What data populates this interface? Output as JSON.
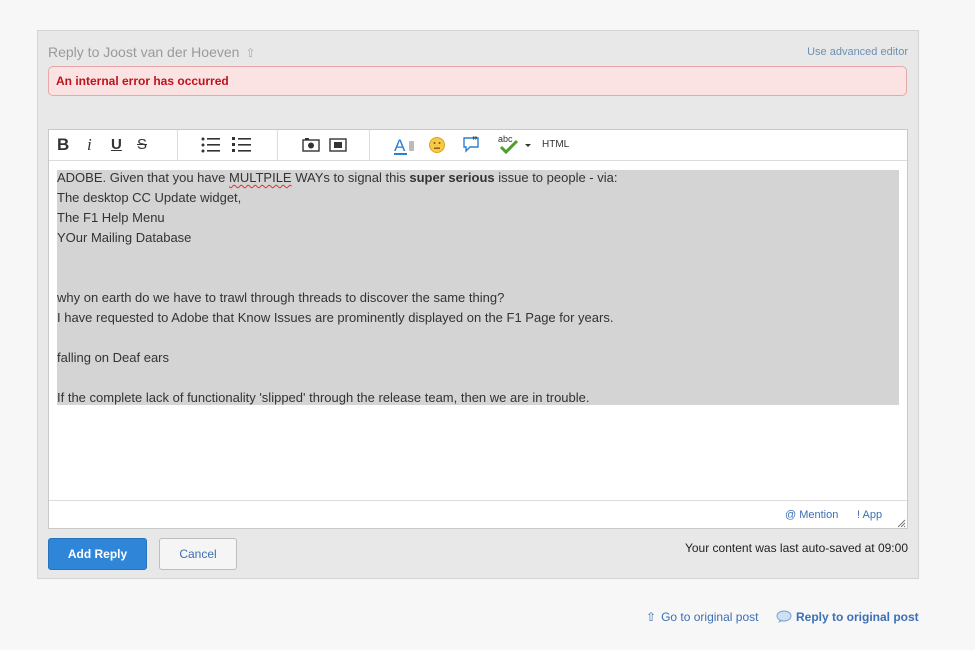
{
  "reply_header": {
    "title": "Reply to Joost van der Hoeven",
    "advanced_editor_link": "Use advanced editor"
  },
  "error": {
    "message": "An internal error has occurred"
  },
  "toolbar": {
    "bold": "B",
    "italic": "i",
    "underline": "U",
    "strike": "S",
    "spellcheck_abc": "abc",
    "html": "HTML",
    "icons": [
      "bold-icon",
      "italic-icon",
      "underline-icon",
      "strikethrough-icon",
      "bulleted-list-icon",
      "numbered-list-icon",
      "insert-image-icon",
      "insert-video-icon",
      "font-style-icon",
      "emoji-icon",
      "quote-icon",
      "spellcheck-icon",
      "html-icon"
    ]
  },
  "body_text": {
    "line1_pre": "ADOBE. Given that you have ",
    "line1_misspelled": "MULTPILE",
    "line1_mid": " WAYs to signal this ",
    "line1_bold": "super serious",
    "line1_post": " issue to people - via:",
    "line2": "The desktop CC Update widget,",
    "line3": "The F1 Help Menu",
    "line4": "YOur Mailing Database",
    "line5": "why on earth do we have to trawl through threads to discover the same thing?",
    "line6": "I have requested to Adobe that Know Issues are prominently displayed on the F1 Page for years.",
    "line7": "falling on Deaf ears",
    "line8": "If the complete lack of functionality 'slipped' through the release team, then we are in trouble."
  },
  "editor_footer": {
    "mention": "@ Mention",
    "app": "! App"
  },
  "actions": {
    "add_reply": "Add Reply",
    "cancel": "Cancel",
    "autosave": "Your content was last auto-saved at 09:00"
  },
  "bottom_links": {
    "go_to_original": "Go to original post",
    "reply_to_original": "Reply to original post"
  },
  "colors": {
    "accent": "#2f86d9",
    "link": "#3d6fb4",
    "error_text": "#c0121b",
    "error_bg": "#fbe3e3",
    "selection": "#d4d4d4"
  }
}
